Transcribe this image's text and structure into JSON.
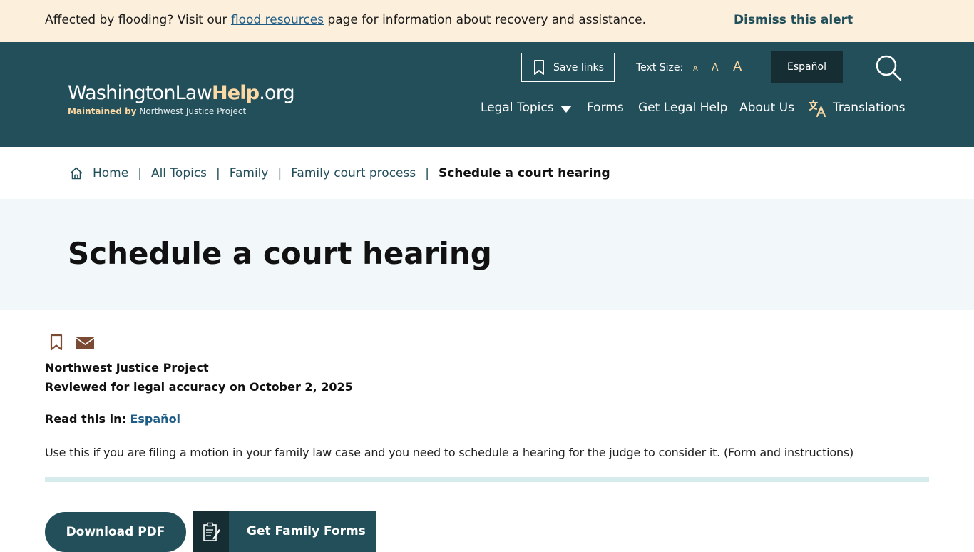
{
  "alert": {
    "text_before": "Affected by flooding? Visit our ",
    "link": "flood resources",
    "text_after": " page for information about recovery and assistance.",
    "dismiss": "Dismiss this alert"
  },
  "header": {
    "logo_main": "WashingtonLaw",
    "logo_help": "Help",
    "logo_tld": ".org",
    "logo_by": "Maintained by",
    "logo_org": "Northwest Justice Project",
    "save_links": "Save links",
    "text_size_label": "Text Size:",
    "text_size_options": [
      "A",
      "A",
      "A"
    ],
    "espanol": "Español",
    "nav": {
      "legal_topics": "Legal Topics",
      "forms": "Forms",
      "get_legal_help": "Get Legal Help",
      "about_us": "About Us",
      "translations": "Translations"
    }
  },
  "breadcrumb": {
    "items": [
      "Home",
      "All Topics",
      "Family",
      "Family court process"
    ],
    "separator": "|",
    "current": "Schedule a court hearing"
  },
  "page": {
    "title": "Schedule a court hearing",
    "author": "Northwest Justice Project",
    "reviewed": "Reviewed for legal accuracy on October 2, 2025",
    "read_in_label": "Read this in:",
    "read_in_link": "Español",
    "summary": "Use this if you are filing a motion in your family law case and you need to schedule a hearing for the judge to consider it. (Form and instructions)",
    "download_pdf": "Download PDF",
    "get_family_forms": "Get Family Forms"
  },
  "colors": {
    "header_bg": "#224f5a",
    "alert_bg": "#fcefdc",
    "accent": "#fcd9a4",
    "title_band_bg": "#f2f7f9",
    "icon_brown": "#7a4a33"
  },
  "icons": {
    "save": "bookmark-icon",
    "search": "search-icon",
    "translations": "translate-icon",
    "home": "home-icon",
    "email": "mail-icon",
    "forms": "clipboard-icon"
  }
}
